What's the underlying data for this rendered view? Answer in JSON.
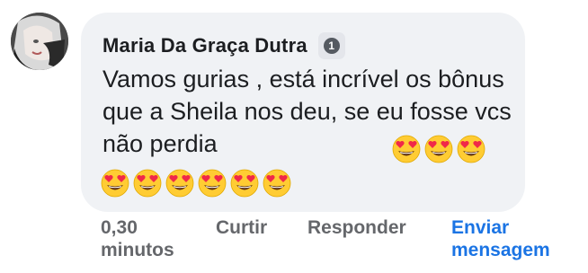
{
  "comment": {
    "author": "Maria Da Graça Dutra",
    "badge": "1",
    "text": "Vamos gurias , está incrível os bônus que a Sheila nos deu, se eu fosse vcs não perdia",
    "emoji_name": "smiling-face-with-heart-eyes",
    "emoji_inline_count": 3,
    "emoji_second_line_count": 6,
    "colors": {
      "bubble": "#f0f2f5",
      "text": "#1c1e21",
      "meta": "#65676b",
      "link": "#1b74e4",
      "emoji_face": "#ffcc33",
      "emoji_heart": "#f02849"
    }
  },
  "actions": {
    "time": "0,30 minutos",
    "like": "Curtir",
    "reply": "Responder",
    "send_message": "Enviar mensagem"
  }
}
